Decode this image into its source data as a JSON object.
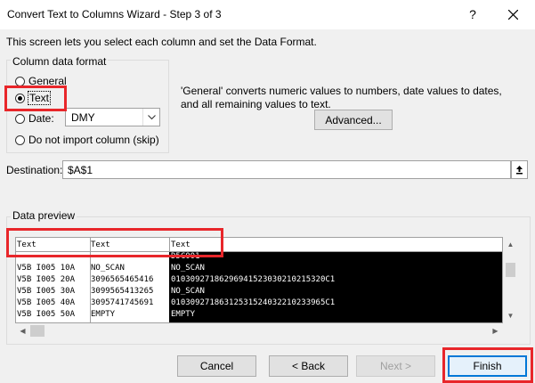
{
  "window": {
    "title": "Convert Text to Columns Wizard - Step 3 of 3",
    "help_label": "?"
  },
  "intro_text": "This screen lets you select each column and set the Data Format.",
  "column_format": {
    "legend": "Column data format",
    "options": [
      "General",
      "Text",
      "Date:",
      "Do not import column (skip)"
    ],
    "selected": "Text",
    "date_format": "DMY"
  },
  "description": "'General' converts numeric values to numbers, date values to dates, and all remaining values to text.",
  "advanced_label": "Advanced...",
  "destination": {
    "label": "Destination:",
    "value": "$A$1"
  },
  "preview": {
    "legend": "Data preview",
    "headers": [
      "Text",
      "Text",
      "Text"
    ],
    "rows": [
      [
        "",
        "",
        "D5C001"
      ],
      [
        "V5B I005 10A",
        "NO_SCAN",
        "NO_SCAN"
      ],
      [
        "V5B I005 20A",
        "3096565465416",
        "01030927186296941523030210215320C1"
      ],
      [
        "V5B I005 30A",
        "3099565413265",
        "NO_SCAN"
      ],
      [
        "V5B I005 40A",
        "3095741745691",
        "01030927186312531524032210233965C1"
      ],
      [
        "V5B I005 50A",
        "EMPTY",
        "EMPTY"
      ]
    ]
  },
  "buttons": {
    "cancel": "Cancel",
    "back": "< Back",
    "next": "Next >",
    "finish": "Finish"
  },
  "colors": {
    "highlight": "#e8262a",
    "accent": "#0078d7"
  }
}
